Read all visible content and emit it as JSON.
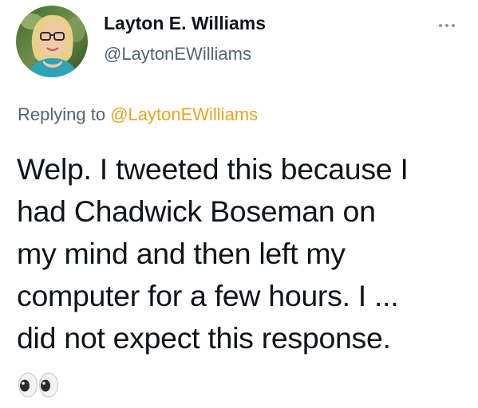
{
  "author": {
    "display_name": "Layton E. Williams",
    "handle": "@LaytonEWilliams",
    "avatar_icon": "profile-photo"
  },
  "more_icon": "more-horizontal-icon",
  "reply": {
    "prefix": "Replying to ",
    "handle": "@LaytonEWilliams",
    "handle_color": "#e6a522"
  },
  "tweet": {
    "lines": [
      "Welp. I tweeted this because I",
      "had Chadwick Boseman on",
      "my mind and then left my",
      "computer for a few hours. I ...",
      "did not expect this response."
    ],
    "emoji": "👀",
    "emoji_icon": "eyes-emoji-icon"
  }
}
